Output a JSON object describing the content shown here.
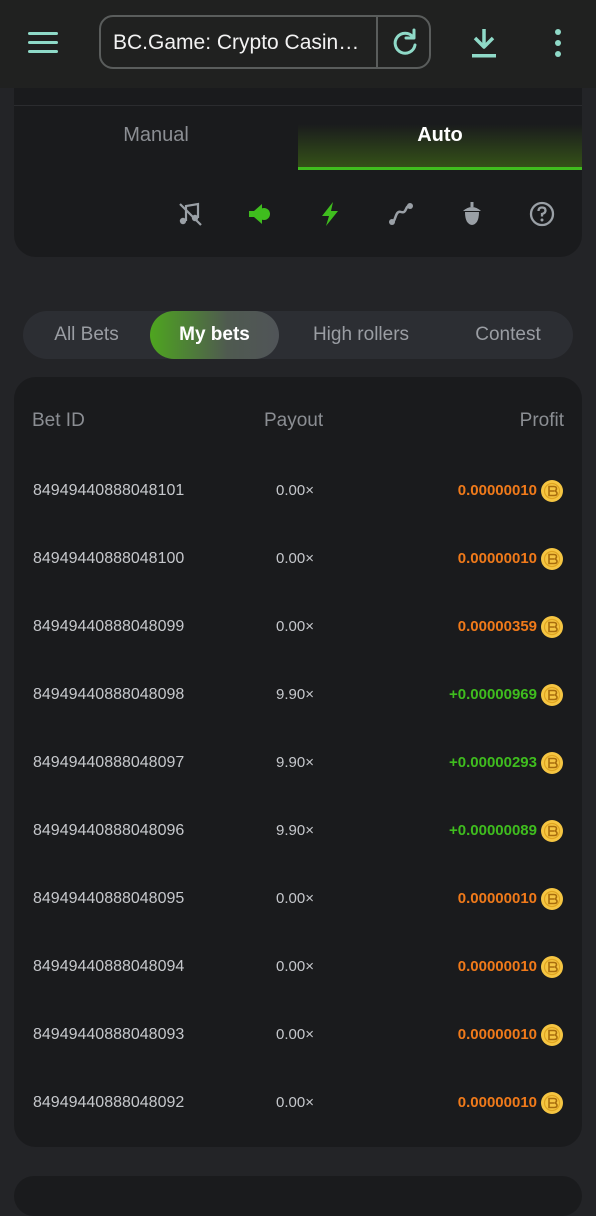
{
  "browser": {
    "url_title": "BC.Game: Crypto Casino Games & Casino Slot Games - Crypto Gaming",
    "icons": [
      "menu-icon",
      "reload-icon",
      "download-icon",
      "more-vertical-icon"
    ],
    "accent": "#8fdac8"
  },
  "panel": {
    "tabs": [
      {
        "label": "Manual",
        "active": false
      },
      {
        "label": "Auto",
        "active": true
      }
    ],
    "tools": [
      "music-off-icon",
      "sound-on-icon",
      "lightning-icon",
      "graph-icon",
      "acorn-icon",
      "help-icon"
    ],
    "active_color": "#3fbd1e"
  },
  "bets_tabs": {
    "items": [
      {
        "label": "All Bets",
        "active": false
      },
      {
        "label": "My bets",
        "active": true
      },
      {
        "label": "High rollers",
        "active": false
      },
      {
        "label": "Contest",
        "active": false
      }
    ]
  },
  "bets_table": {
    "headers": {
      "bet_id": "Bet ID",
      "payout": "Payout",
      "profit": "Profit"
    },
    "rows": [
      {
        "bet_id": "84949440888048101",
        "payout": "0.00×",
        "profit": "0.00000010",
        "status": "loss"
      },
      {
        "bet_id": "84949440888048100",
        "payout": "0.00×",
        "profit": "0.00000010",
        "status": "loss"
      },
      {
        "bet_id": "84949440888048099",
        "payout": "0.00×",
        "profit": "0.00000359",
        "status": "loss"
      },
      {
        "bet_id": "84949440888048098",
        "payout": "9.90×",
        "profit": "+0.00000969",
        "status": "win"
      },
      {
        "bet_id": "84949440888048097",
        "payout": "9.90×",
        "profit": "+0.00000293",
        "status": "win"
      },
      {
        "bet_id": "84949440888048096",
        "payout": "9.90×",
        "profit": "+0.00000089",
        "status": "win"
      },
      {
        "bet_id": "84949440888048095",
        "payout": "0.00×",
        "profit": "0.00000010",
        "status": "loss"
      },
      {
        "bet_id": "84949440888048094",
        "payout": "0.00×",
        "profit": "0.00000010",
        "status": "loss"
      },
      {
        "bet_id": "84949440888048093",
        "payout": "0.00×",
        "profit": "0.00000010",
        "status": "loss"
      },
      {
        "bet_id": "84949440888048092",
        "payout": "0.00×",
        "profit": "0.00000010",
        "status": "loss"
      }
    ],
    "colors": {
      "win": "#3fbd1e",
      "loss": "#f07a1a",
      "coin": "#f5c542"
    },
    "coin_icon": "coin-icon"
  }
}
